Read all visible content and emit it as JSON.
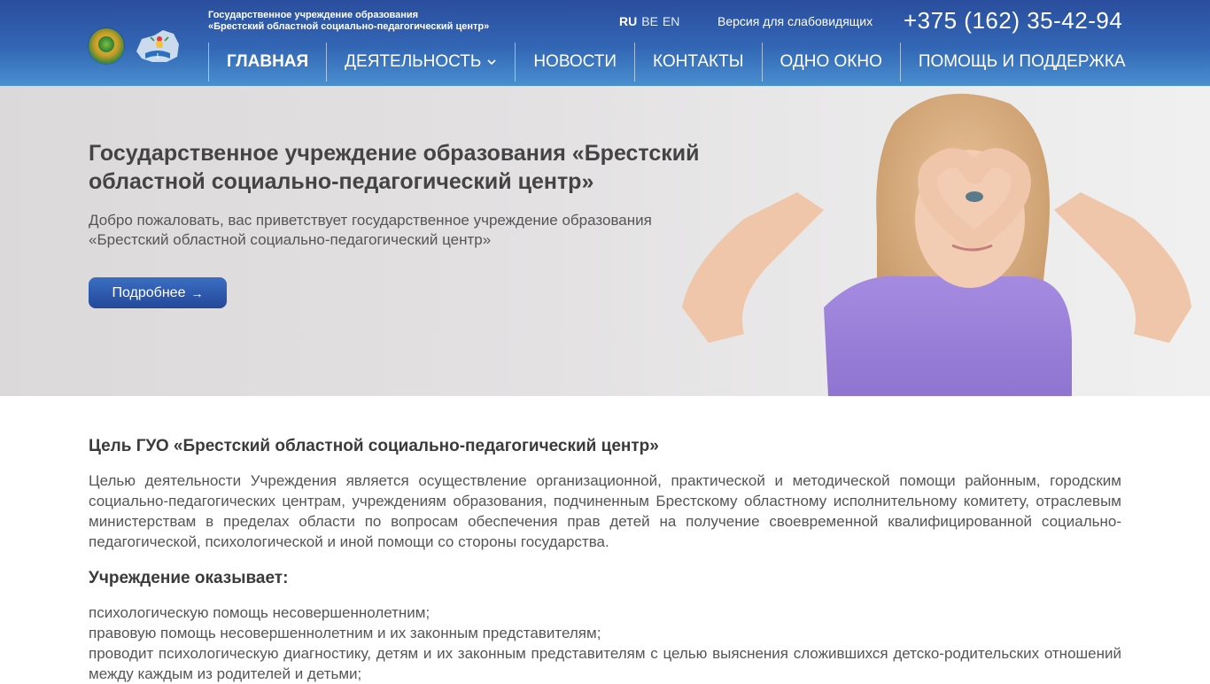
{
  "header": {
    "org_line1": "Государственное учреждение образования",
    "org_line2": "«Брестский областной социально-педагогический центр»",
    "languages": [
      {
        "code": "RU",
        "active": true
      },
      {
        "code": "BE",
        "active": false
      },
      {
        "code": "EN",
        "active": false
      }
    ],
    "lowvision_label": "Версия для слабовидящих",
    "phone": "+375 (162) 35-42-94",
    "nav": [
      {
        "label": "ГЛАВНАЯ",
        "active": true
      },
      {
        "label": "ДЕЯТЕЛЬНОСТЬ",
        "has_dropdown": true
      },
      {
        "label": "НОВОСТИ"
      },
      {
        "label": "КОНТАКТЫ"
      },
      {
        "label": "ОДНО ОКНО"
      },
      {
        "label": "ПОМОЩЬ И ПОДДЕРЖКА"
      }
    ],
    "colors": {
      "header_top": "#2b4e9e",
      "header_bottom": "#4a8fd0"
    }
  },
  "hero": {
    "title": "Государственное учреждение образования «Брестский областной социально-педагогический центр»",
    "subtitle": "Добро пожаловать, вас приветствует государственное учреждение образования «Брестский областной социально-педагогический центр»",
    "button_label": "Подробнее",
    "button_icon": "arrow-right-icon",
    "image": "girl-heart-hands-photo"
  },
  "content": {
    "goal_heading": "Цель ГУО «Брестский областной социально-педагогический центр»",
    "goal_text": "Целью деятельности Учреждения является осуществление организационной, практической и методической помощи районным, городским социально-педагогических центрам, учреждениям образования, подчиненным Брестскому областному исполнительному комитету, отраслевым министерствам в пределах области по вопросам обеспечения прав детей на получение своевременной квалифицированной социально-педагогической, психологической и иной помощи со стороны государства.",
    "services_heading": "Учреждение оказывает:",
    "services": [
      "психологическую помощь несовершеннолетним;",
      "правовую помощь несовершеннолетним и их законным представителям;",
      "проводит психологическую диагностику, детям и их законным представителям с целью выяснения сложившихся детско-родительских отношений между каждым из родителей и детьми;"
    ]
  }
}
